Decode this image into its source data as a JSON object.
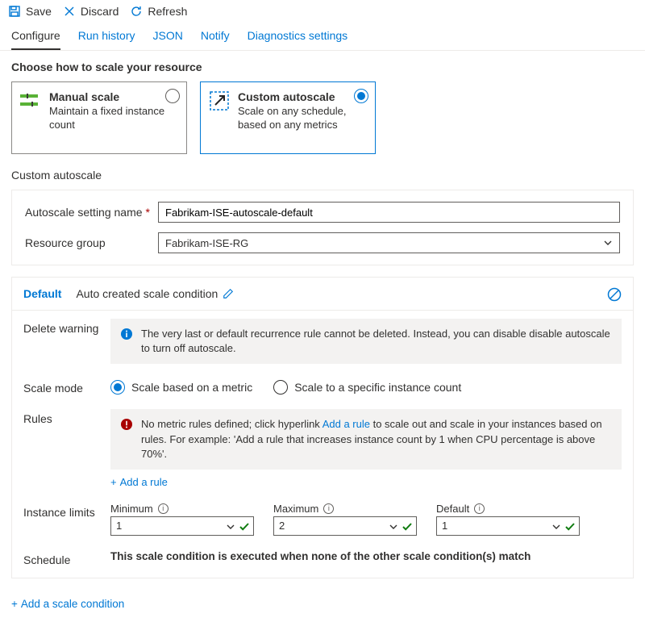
{
  "toolbar": {
    "save": "Save",
    "discard": "Discard",
    "refresh": "Refresh"
  },
  "tabs": {
    "configure": "Configure",
    "run_history": "Run history",
    "json": "JSON",
    "notify": "Notify",
    "diagnostics": "Diagnostics settings"
  },
  "choose_heading": "Choose how to scale your resource",
  "options": {
    "manual": {
      "title": "Manual scale",
      "desc": "Maintain a fixed instance count"
    },
    "custom": {
      "title": "Custom autoscale",
      "desc": "Scale on any schedule, based on any metrics"
    }
  },
  "subheading": "Custom autoscale",
  "form": {
    "setting_name_label": "Autoscale setting name",
    "setting_name_value": "Fabrikam-ISE-autoscale-default",
    "resource_group_label": "Resource group",
    "resource_group_value": "Fabrikam-ISE-RG"
  },
  "panel": {
    "title": "Default",
    "subtitle": "Auto created scale condition",
    "delete_warning_label": "Delete warning",
    "delete_warning_text": "The very last or default recurrence rule cannot be deleted. Instead, you can disable disable autoscale to turn off autoscale.",
    "scale_mode_label": "Scale mode",
    "scale_mode_metric": "Scale based on a metric",
    "scale_mode_count": "Scale to a specific instance count",
    "rules_label": "Rules",
    "rules_warning_pre": "No metric rules defined; click hyperlink ",
    "rules_warning_link": "Add a rule",
    "rules_warning_post": " to scale out and scale in your instances based on rules. For example: 'Add a rule that increases instance count by 1 when CPU percentage is above 70%'.",
    "add_rule": "Add a rule",
    "instance_limits_label": "Instance limits",
    "limits": {
      "min_label": "Minimum",
      "min_value": "1",
      "max_label": "Maximum",
      "max_value": "2",
      "def_label": "Default",
      "def_value": "1"
    },
    "schedule_label": "Schedule",
    "schedule_text": "This scale condition is executed when none of the other scale condition(s) match"
  },
  "footer": {
    "add_condition": "Add a scale condition"
  }
}
